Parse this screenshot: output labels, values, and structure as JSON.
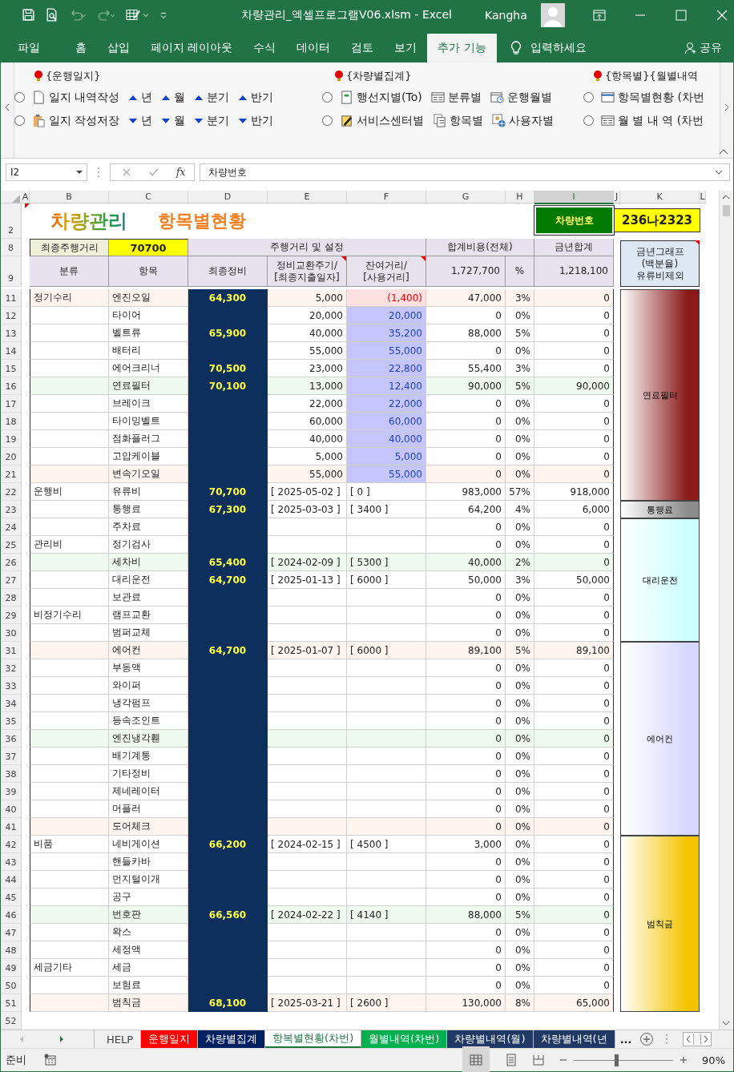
{
  "window": {
    "title": "차량관리_엑셀프로그램V06.xlsm  -  Excel",
    "user": "Kangha"
  },
  "ribbon_tabs": [
    {
      "label": "파일",
      "selected": false
    },
    {
      "label": "홈",
      "selected": false
    },
    {
      "label": "삽입",
      "selected": false
    },
    {
      "label": "페이지 레이아웃",
      "selected": false
    },
    {
      "label": "수식",
      "selected": false
    },
    {
      "label": "데이터",
      "selected": false
    },
    {
      "label": "검토",
      "selected": false
    },
    {
      "label": "보기",
      "selected": false
    },
    {
      "label": "추가 기능",
      "selected": true
    }
  ],
  "tell_me": "입력하세요",
  "share": "공유",
  "ribbon": {
    "groups": [
      {
        "title": "{운행일지}",
        "rows": [
          [
            {
              "kind": "radio",
              "checked": false
            },
            {
              "kind": "page",
              "label": "일지 내역작성"
            },
            {
              "kind": "up",
              "label": "년"
            },
            {
              "kind": "up",
              "label": "월"
            },
            {
              "kind": "up",
              "label": "분기"
            },
            {
              "kind": "up",
              "label": "반기"
            }
          ],
          [
            {
              "kind": "radio",
              "checked": false
            },
            {
              "kind": "clipboard",
              "label": "일지 작성저장"
            },
            {
              "kind": "down",
              "label": "년"
            },
            {
              "kind": "down",
              "label": "월"
            },
            {
              "kind": "down",
              "label": "분기"
            },
            {
              "kind": "down",
              "label": "반기"
            }
          ]
        ]
      },
      {
        "title": "{차량별집계}",
        "rows": [
          [
            {
              "kind": "radio",
              "checked": false
            },
            {
              "kind": "form",
              "label": "행선지별(To)"
            },
            {
              "kind": "list",
              "label": "분류별"
            },
            {
              "kind": "calendar",
              "label": "운행월별"
            }
          ],
          [
            {
              "kind": "radio",
              "checked": false
            },
            {
              "kind": "edit",
              "label": "서비스센터별"
            },
            {
              "kind": "copy",
              "label": "항목별"
            },
            {
              "kind": "user",
              "label": "사용자별"
            }
          ]
        ]
      },
      {
        "title": "{항목별}{월별내역",
        "rows": [
          [
            {
              "kind": "radio",
              "checked": false
            },
            {
              "kind": "window",
              "label": "항목별현황 (차번"
            }
          ],
          [
            {
              "kind": "radio",
              "checked": false
            },
            {
              "kind": "list",
              "label": "월 별 내 역 (차번"
            }
          ]
        ]
      }
    ]
  },
  "formula_bar": {
    "name_box": "I2",
    "fx": "fx",
    "value": "차량번호"
  },
  "columns": [
    {
      "label": "A",
      "selected": false
    },
    {
      "label": "B",
      "selected": false
    },
    {
      "label": "C",
      "selected": false
    },
    {
      "label": "D",
      "selected": false
    },
    {
      "label": "E",
      "selected": false
    },
    {
      "label": "F",
      "selected": false
    },
    {
      "label": "G",
      "selected": false
    },
    {
      "label": "H",
      "selected": false
    },
    {
      "label": "I",
      "selected": true
    },
    {
      "label": "J",
      "selected": false
    },
    {
      "label": "K",
      "selected": false
    },
    {
      "label": "L",
      "selected": false
    }
  ],
  "sheet": {
    "title_row": "2",
    "title": "차량관리",
    "subtitle": "항목별현황",
    "vehicle_label": "차량번호",
    "vehicle_no": "236나2323",
    "header_rows": [
      "8",
      "9"
    ],
    "last_mileage_label": "최종주행거리",
    "last_mileage": "70700",
    "mileage_settings": "주행거리 및 설정",
    "total_cost_label": "합계비용(전체)",
    "year_total_label": "금년합계",
    "graph_label": "금년그래프\n(백분율)\n유류비제외",
    "col_category": "분류",
    "col_item": "항목",
    "col_last": "최종정비",
    "col_cycle": "정비교환주기/\n[최종지출일자]",
    "col_remain": "잔여거리/\n[사용거리]",
    "total_cost": "1,727,700",
    "col_pct": "%",
    "year_total": "1,218,100",
    "rows": [
      {
        "n": "11",
        "cat": "정기수리",
        "item": "엔진오일",
        "last": "64,300",
        "e": "5,000",
        "f": "(1,400)",
        "g": "47,000",
        "h": "3%",
        "i": "0",
        "kind": "cycle",
        "overdue": true,
        "color": "#fff4ee"
      },
      {
        "n": "12",
        "cat": "",
        "item": "타이어",
        "last": "",
        "e": "20,000",
        "f": "20,000",
        "g": "0",
        "h": "0%",
        "i": "0",
        "kind": "cycle",
        "overdue": false,
        "color": "#ffffff"
      },
      {
        "n": "13",
        "cat": "",
        "item": "벨트류",
        "last": "65,900",
        "e": "40,000",
        "f": "35,200",
        "g": "88,000",
        "h": "5%",
        "i": "0",
        "kind": "cycle",
        "overdue": false,
        "color": "#ffffff"
      },
      {
        "n": "14",
        "cat": "",
        "item": "배터리",
        "last": "",
        "e": "55,000",
        "f": "55,000",
        "g": "0",
        "h": "0%",
        "i": "0",
        "kind": "cycle",
        "overdue": false,
        "color": "#ffffff"
      },
      {
        "n": "15",
        "cat": "",
        "item": "에어크리너",
        "last": "70,500",
        "e": "23,000",
        "f": "22,800",
        "g": "55,400",
        "h": "3%",
        "i": "0",
        "kind": "cycle",
        "overdue": false,
        "color": "#ffffff"
      },
      {
        "n": "16",
        "cat": "",
        "item": "연료필터",
        "last": "70,100",
        "e": "13,000",
        "f": "12,400",
        "g": "90,000",
        "h": "5%",
        "i": "90,000",
        "kind": "cycle",
        "overdue": false,
        "color": "#eefaee"
      },
      {
        "n": "17",
        "cat": "",
        "item": "브레이크",
        "last": "",
        "e": "22,000",
        "f": "22,000",
        "g": "0",
        "h": "0%",
        "i": "0",
        "kind": "cycle",
        "overdue": false,
        "color": "#ffffff"
      },
      {
        "n": "18",
        "cat": "",
        "item": "타이밍벨트",
        "last": "",
        "e": "60,000",
        "f": "60,000",
        "g": "0",
        "h": "0%",
        "i": "0",
        "kind": "cycle",
        "overdue": false,
        "color": "#ffffff"
      },
      {
        "n": "19",
        "cat": "",
        "item": "점화플러그",
        "last": "",
        "e": "40,000",
        "f": "40,000",
        "g": "0",
        "h": "0%",
        "i": "0",
        "kind": "cycle",
        "overdue": false,
        "color": "#ffffff"
      },
      {
        "n": "20",
        "cat": "",
        "item": "고압케이블",
        "last": "",
        "e": "5,000",
        "f": "5,000",
        "g": "0",
        "h": "0%",
        "i": "0",
        "kind": "cycle",
        "overdue": false,
        "color": "#ffffff"
      },
      {
        "n": "21",
        "cat": "",
        "item": "변속기오일",
        "last": "",
        "e": "55,000",
        "f": "55,000",
        "g": "0",
        "h": "0%",
        "i": "0",
        "kind": "cycle",
        "overdue": false,
        "color": "#fff4ee"
      },
      {
        "n": "22",
        "cat": "운행비",
        "item": "유류비",
        "last": "70,700",
        "e": "[ 2025-05-02 ]",
        "f": "[ 0 ]",
        "g": "983,000",
        "h": "57%",
        "i": "918,000",
        "kind": "dated",
        "color": "#ffffff"
      },
      {
        "n": "23",
        "cat": "",
        "item": "통행료",
        "last": "67,300",
        "e": "[ 2025-03-03 ]",
        "f": "[ 3400 ]",
        "g": "64,200",
        "h": "4%",
        "i": "6,000",
        "kind": "dated",
        "color": "#ffffff"
      },
      {
        "n": "24",
        "cat": "",
        "item": "주차료",
        "last": "",
        "e": "",
        "f": "",
        "g": "0",
        "h": "0%",
        "i": "0",
        "kind": "dated",
        "color": "#ffffff"
      },
      {
        "n": "25",
        "cat": "관리비",
        "item": "정기검사",
        "last": "",
        "e": "",
        "f": "",
        "g": "0",
        "h": "0%",
        "i": "0",
        "kind": "dated",
        "color": "#ffffff"
      },
      {
        "n": "26",
        "cat": "",
        "item": "세차비",
        "last": "65,400",
        "e": "[ 2024-02-09 ]",
        "f": "[ 5300 ]",
        "g": "40,000",
        "h": "2%",
        "i": "0",
        "kind": "dated",
        "color": "#eefaee"
      },
      {
        "n": "27",
        "cat": "",
        "item": "대리운전",
        "last": "64,700",
        "e": "[ 2025-01-13 ]",
        "f": "[ 6000 ]",
        "g": "50,000",
        "h": "3%",
        "i": "50,000",
        "kind": "dated",
        "color": "#ffffff"
      },
      {
        "n": "28",
        "cat": "",
        "item": "보관료",
        "last": "",
        "e": "",
        "f": "",
        "g": "0",
        "h": "0%",
        "i": "0",
        "kind": "dated",
        "color": "#ffffff"
      },
      {
        "n": "29",
        "cat": "비정기수리",
        "item": "램프교환",
        "last": "",
        "e": "",
        "f": "",
        "g": "0",
        "h": "0%",
        "i": "0",
        "kind": "dated",
        "color": "#ffffff"
      },
      {
        "n": "30",
        "cat": "",
        "item": "범퍼교체",
        "last": "",
        "e": "",
        "f": "",
        "g": "0",
        "h": "0%",
        "i": "0",
        "kind": "dated",
        "color": "#ffffff"
      },
      {
        "n": "31",
        "cat": "",
        "item": "에어컨",
        "last": "64,700",
        "e": "[ 2025-01-07 ]",
        "f": "[ 6000 ]",
        "g": "89,100",
        "h": "5%",
        "i": "89,100",
        "kind": "dated",
        "color": "#fff4ee"
      },
      {
        "n": "32",
        "cat": "",
        "item": "부동액",
        "last": "",
        "e": "",
        "f": "",
        "g": "0",
        "h": "0%",
        "i": "0",
        "kind": "dated",
        "color": "#ffffff"
      },
      {
        "n": "33",
        "cat": "",
        "item": "와이퍼",
        "last": "",
        "e": "",
        "f": "",
        "g": "0",
        "h": "0%",
        "i": "0",
        "kind": "dated",
        "color": "#ffffff"
      },
      {
        "n": "34",
        "cat": "",
        "item": "냉각펌프",
        "last": "",
        "e": "",
        "f": "",
        "g": "0",
        "h": "0%",
        "i": "0",
        "kind": "dated",
        "color": "#ffffff"
      },
      {
        "n": "35",
        "cat": "",
        "item": "등속조인트",
        "last": "",
        "e": "",
        "f": "",
        "g": "0",
        "h": "0%",
        "i": "0",
        "kind": "dated",
        "color": "#ffffff"
      },
      {
        "n": "36",
        "cat": "",
        "item": "엔진냉각휀",
        "last": "",
        "e": "",
        "f": "",
        "g": "0",
        "h": "0%",
        "i": "0",
        "kind": "dated",
        "color": "#eefaee"
      },
      {
        "n": "37",
        "cat": "",
        "item": "배기계통",
        "last": "",
        "e": "",
        "f": "",
        "g": "0",
        "h": "0%",
        "i": "0",
        "kind": "dated",
        "color": "#ffffff"
      },
      {
        "n": "38",
        "cat": "",
        "item": "기타정비",
        "last": "",
        "e": "",
        "f": "",
        "g": "0",
        "h": "0%",
        "i": "0",
        "kind": "dated",
        "color": "#ffffff"
      },
      {
        "n": "39",
        "cat": "",
        "item": "제네레이터",
        "last": "",
        "e": "",
        "f": "",
        "g": "0",
        "h": "0%",
        "i": "0",
        "kind": "dated",
        "color": "#ffffff"
      },
      {
        "n": "40",
        "cat": "",
        "item": "머플러",
        "last": "",
        "e": "",
        "f": "",
        "g": "0",
        "h": "0%",
        "i": "0",
        "kind": "dated",
        "color": "#ffffff"
      },
      {
        "n": "41",
        "cat": "",
        "item": "도어체크",
        "last": "",
        "e": "",
        "f": "",
        "g": "0",
        "h": "0%",
        "i": "0",
        "kind": "dated",
        "color": "#fff4ee"
      },
      {
        "n": "42",
        "cat": "비품",
        "item": "네비게이션",
        "last": "66,200",
        "e": "[ 2024-02-15 ]",
        "f": "[ 4500 ]",
        "g": "3,000",
        "h": "0%",
        "i": "0",
        "kind": "dated",
        "color": "#ffffff"
      },
      {
        "n": "43",
        "cat": "",
        "item": "핸들카바",
        "last": "",
        "e": "",
        "f": "",
        "g": "0",
        "h": "0%",
        "i": "0",
        "kind": "dated",
        "color": "#ffffff"
      },
      {
        "n": "44",
        "cat": "",
        "item": "먼지털이개",
        "last": "",
        "e": "",
        "f": "",
        "g": "0",
        "h": "0%",
        "i": "0",
        "kind": "dated",
        "color": "#ffffff"
      },
      {
        "n": "45",
        "cat": "",
        "item": "공구",
        "last": "",
        "e": "",
        "f": "",
        "g": "0",
        "h": "0%",
        "i": "0",
        "kind": "dated",
        "color": "#ffffff"
      },
      {
        "n": "46",
        "cat": "",
        "item": "번호판",
        "last": "66,560",
        "e": "[ 2024-02-22 ]",
        "f": "[ 4140 ]",
        "g": "88,000",
        "h": "5%",
        "i": "0",
        "kind": "dated",
        "color": "#eefaee"
      },
      {
        "n": "47",
        "cat": "",
        "item": "왁스",
        "last": "",
        "e": "",
        "f": "",
        "g": "0",
        "h": "0%",
        "i": "0",
        "kind": "dated",
        "color": "#ffffff"
      },
      {
        "n": "48",
        "cat": "",
        "item": "세정액",
        "last": "",
        "e": "",
        "f": "",
        "g": "0",
        "h": "0%",
        "i": "0",
        "kind": "dated",
        "color": "#ffffff"
      },
      {
        "n": "49",
        "cat": "세금기타",
        "item": "세금",
        "last": "",
        "e": "",
        "f": "",
        "g": "0",
        "h": "0%",
        "i": "0",
        "kind": "dated",
        "color": "#ffffff"
      },
      {
        "n": "50",
        "cat": "",
        "item": "보험료",
        "last": "",
        "e": "",
        "f": "",
        "g": "0",
        "h": "0%",
        "i": "0",
        "kind": "dated",
        "color": "#ffffff"
      },
      {
        "n": "51",
        "cat": "",
        "item": "범칙금",
        "last": "68,100",
        "e": "[ 2025-03-21 ]",
        "f": "[ 2600 ]",
        "g": "130,000",
        "h": "8%",
        "i": "65,000",
        "kind": "dated",
        "color": "#fff4ee"
      }
    ],
    "graph": [
      {
        "label": "연료필터",
        "color": "#8b1a1a"
      },
      {
        "label": "통행료",
        "color": "#8c8c8c"
      },
      {
        "label": "대리운전",
        "color": "#ccffff"
      },
      {
        "label": "에어컨",
        "color": "#d8d8ff"
      },
      {
        "label": "범칙금",
        "color": "#f5c400"
      }
    ],
    "last_row": "52"
  },
  "sheet_tabs": [
    {
      "label": "HELP",
      "color": "#f0f0f0",
      "selected": false
    },
    {
      "label": "운행일지",
      "color": "#ff0000",
      "selected": false
    },
    {
      "label": "차량별집계",
      "color": "#002060",
      "selected": false
    },
    {
      "label": "항복별현황(차번)",
      "color": "#ffffff",
      "selected": true
    },
    {
      "label": "월별내역(차번)",
      "color": "#00b050",
      "selected": false
    },
    {
      "label": "차량별내역(월)",
      "color": "#1f3864",
      "selected": false
    },
    {
      "label": "차량별내역(년",
      "color": "#1f3864",
      "selected": false
    }
  ],
  "more_tabs": "...",
  "status_bar": {
    "mode": "준비",
    "zoom": {
      "level": 0.41,
      "reading": "90%"
    }
  }
}
